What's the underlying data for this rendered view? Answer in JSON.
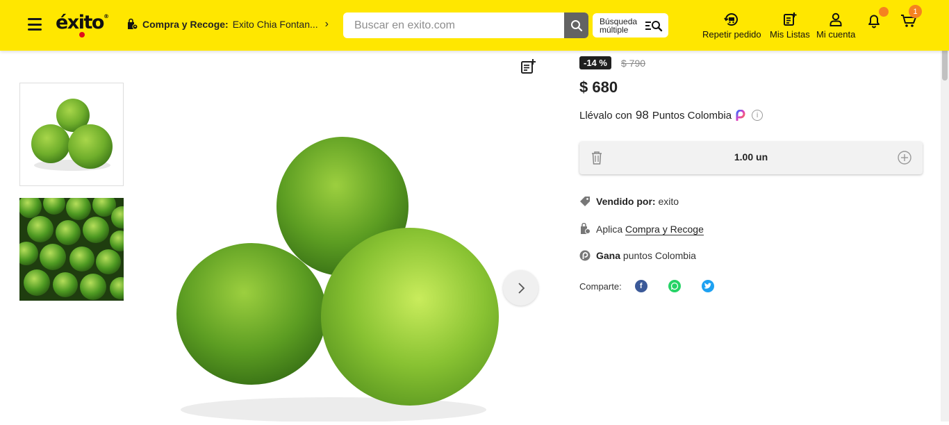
{
  "header": {
    "logo_text": "éxito",
    "logo_reg": "®",
    "pickup_label": "Compra y Recoge:",
    "pickup_store": "Exito Chia Fontan...",
    "search_placeholder": "Buscar en exito.com",
    "multi_search_line1": "Búsqueda",
    "multi_search_line2": "múltiple",
    "repeat_order": "Repetir pedido",
    "my_lists": "Mis Listas",
    "my_account": "Mi cuenta",
    "cart_count": "1",
    "colors": {
      "brand_yellow": "#ffe700",
      "badge_orange": "#f58220",
      "logo_red": "#e10d1b"
    }
  },
  "product": {
    "discount": "-14 %",
    "old_price": "$ 790",
    "price": "$ 680",
    "points_prefix": "Llévalo con",
    "points_value": "98",
    "points_suffix": "Puntos Colombia",
    "quantity": "1.00 un",
    "sold_by_label": "Vendido por:",
    "sold_by_value": "exito",
    "applies_label": "Aplica",
    "applies_link": "Compra y Recoge",
    "earn_label": "Gana",
    "earn_value": "puntos Colombia",
    "share_label": "Comparte:",
    "share_icons": [
      "facebook-icon",
      "whatsapp-icon",
      "twitter-icon"
    ]
  }
}
